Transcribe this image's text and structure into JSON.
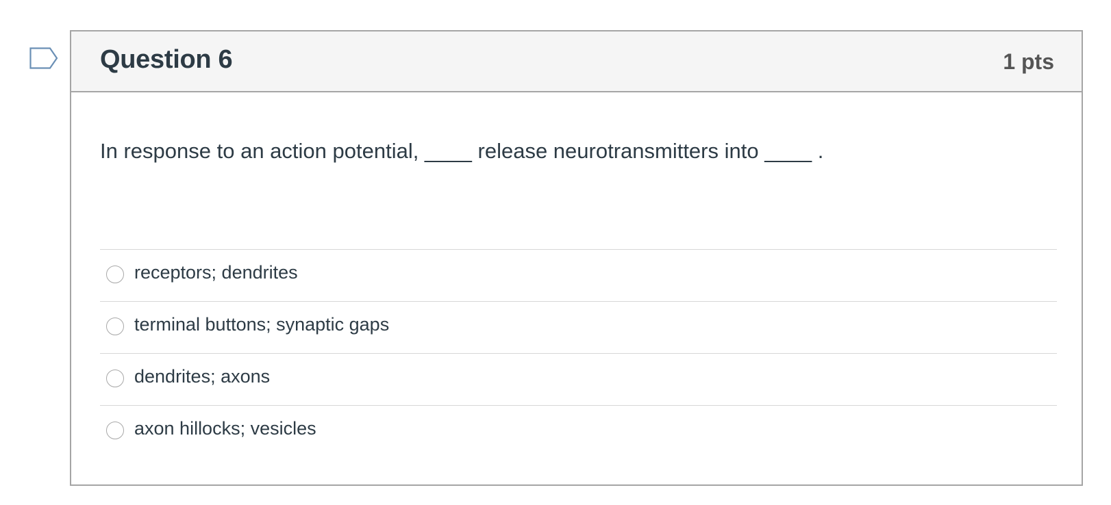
{
  "question": {
    "title": "Question 6",
    "points": "1 pts",
    "text": "In response to an action potential, ____ release neurotransmitters into ____ .",
    "flag_icon": "bookmark-flag-icon",
    "answers": [
      {
        "label": "receptors; dendrites",
        "selected": false
      },
      {
        "label": "terminal buttons; synaptic gaps",
        "selected": false
      },
      {
        "label": "dendrites; axons",
        "selected": false
      },
      {
        "label": "axon hillocks; vesicles",
        "selected": false
      }
    ]
  },
  "colors": {
    "text": "#2d3b45",
    "header_bg": "#f5f5f5",
    "border": "#a5a5a5",
    "flag_stroke": "#6a8fb5"
  }
}
